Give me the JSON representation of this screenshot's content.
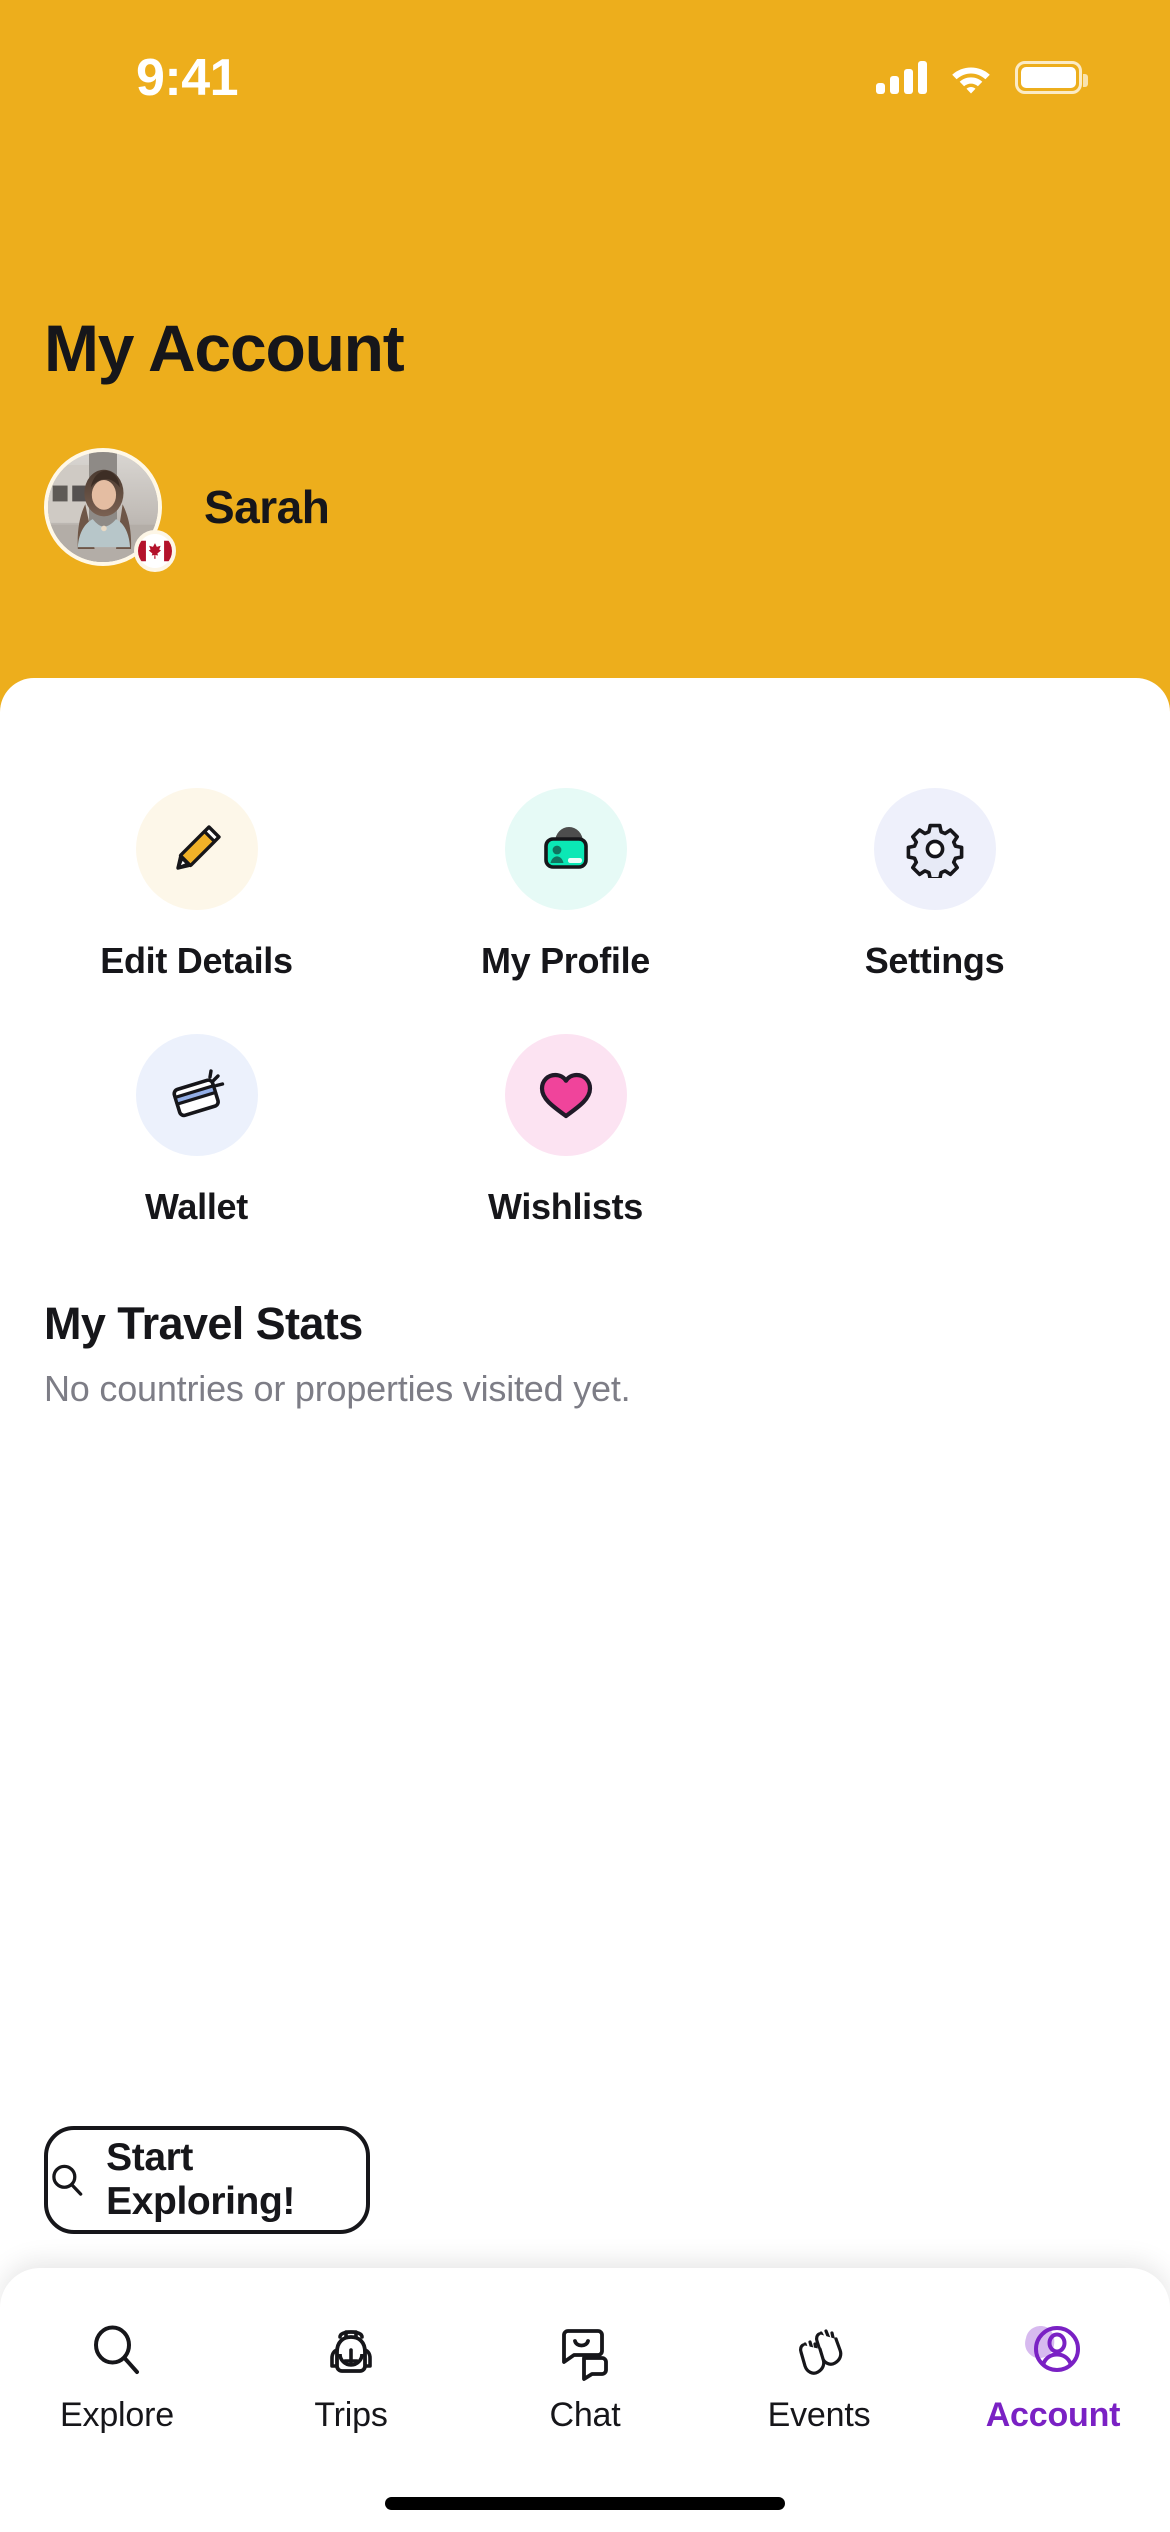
{
  "status_bar": {
    "time": "9:41",
    "signal_icon": "cellular-signal-icon",
    "wifi_icon": "wifi-icon",
    "battery_icon": "battery-icon"
  },
  "header": {
    "title": "My Account",
    "accent_color": "#EDAE1C",
    "profile": {
      "name": "Sarah",
      "avatar_icon": "user-avatar-photo",
      "flag_badge": "canada-flag-badge"
    }
  },
  "actions": [
    {
      "label": "Edit Details",
      "icon": "pencil-icon",
      "circle_color": "#FDF7E9"
    },
    {
      "label": "My Profile",
      "icon": "id-card-icon",
      "circle_color": "#E6FAF6"
    },
    {
      "label": "Settings",
      "icon": "gear-icon",
      "circle_color": "#EEF0FB"
    },
    {
      "label": "Wallet",
      "icon": "credit-card-icon",
      "circle_color": "#ECF1FC"
    },
    {
      "label": "Wishlists",
      "icon": "heart-icon",
      "circle_color": "#FCE3F2"
    }
  ],
  "travel_stats": {
    "title": "My Travel Stats",
    "empty_message": "No countries or properties visited yet."
  },
  "explore_button": {
    "label": "Start Exploring!",
    "icon": "search-icon"
  },
  "bottom_nav": {
    "active_color": "#7A21C4",
    "items": [
      {
        "label": "Explore",
        "icon": "search-icon",
        "active": false
      },
      {
        "label": "Trips",
        "icon": "backpack-icon",
        "active": false
      },
      {
        "label": "Chat",
        "icon": "chat-bubbles-icon",
        "active": false
      },
      {
        "label": "Events",
        "icon": "waving-hands-icon",
        "active": false
      },
      {
        "label": "Account",
        "icon": "user-circle-icon",
        "active": true
      }
    ]
  },
  "home_indicator": "home-indicator-bar"
}
